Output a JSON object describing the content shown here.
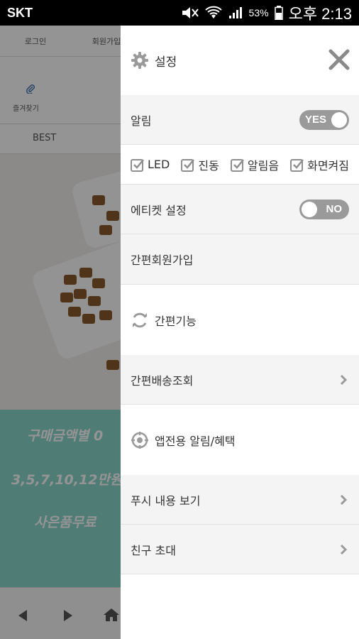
{
  "status_bar": {
    "carrier": "SKT",
    "battery": "53%",
    "time": "오후 2:13"
  },
  "background_page": {
    "nav": [
      "로그인",
      "회원가입"
    ],
    "favorites_label": "즐겨찾기",
    "tab_best": "BEST",
    "promo_lines": [
      "구매금액별 0",
      "3,5,7,10,12만원",
      "사은품무료"
    ]
  },
  "drawer": {
    "header_title": "설정",
    "alarm": {
      "label": "알림",
      "toggle": "YES"
    },
    "check_options": [
      {
        "label": "LED",
        "checked": true
      },
      {
        "label": "진동",
        "checked": true
      },
      {
        "label": "알림음",
        "checked": true
      },
      {
        "label": "화면켜짐",
        "checked": true
      }
    ],
    "etiquette": {
      "label": "에티켓 설정",
      "toggle": "NO"
    },
    "simple_join": "간편회원가입",
    "simple_function": "간편기능",
    "delivery_lookup": "간편배송조회",
    "app_notice": "앱전용 알림/혜택",
    "push_view": "푸시 내용 보기",
    "invite_friend": "친구 초대"
  }
}
